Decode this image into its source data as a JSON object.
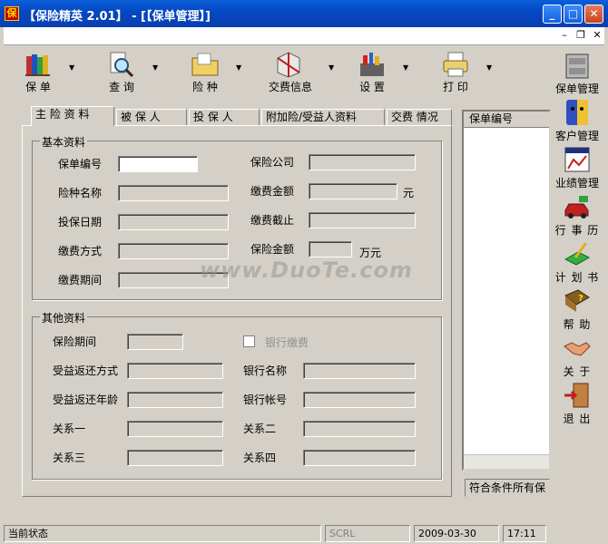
{
  "window": {
    "title": "【保险精英 2.01】 - [【保单管理】]"
  },
  "toolbar": {
    "items": [
      {
        "label": "保 单",
        "icon": "books-icon"
      },
      {
        "label": "查 询",
        "icon": "magnifier-icon"
      },
      {
        "label": "险 种",
        "icon": "folder-icon"
      },
      {
        "label": "交费信息",
        "icon": "wrapped-box-icon"
      },
      {
        "label": "设 置",
        "icon": "tools-icon"
      },
      {
        "label": "打 印",
        "icon": "printer-icon"
      }
    ]
  },
  "tabs": [
    "主 险 资 料",
    "被 保 人",
    "投 保 人",
    "附加险/受益人资料",
    "交费 情况"
  ],
  "basic": {
    "legend": "基本资料",
    "policy_no": "保单编号",
    "plan_name": "险种名称",
    "insure_date": "投保日期",
    "pay_method": "缴费方式",
    "pay_period": "缴费期间",
    "company": "保险公司",
    "pay_amount": "缴费金额",
    "pay_amount_unit": "元",
    "pay_deadline": "缴费截止",
    "insured_amount": "保险金额",
    "insured_amount_unit": "万元"
  },
  "other": {
    "legend": "其他资料",
    "period": "保险期间",
    "bank_pay": "银行缴费",
    "return_method": "受益返还方式",
    "bank_name": "银行名称",
    "return_age": "受益返还年龄",
    "bank_account": "银行帐号",
    "rel1": "关系一",
    "rel2": "关系二",
    "rel3": "关系三",
    "rel4": "关系四"
  },
  "rightlist": {
    "header": "保单编号",
    "footer": "符合条件所有保"
  },
  "sidebar": [
    {
      "label": "保单管理",
      "icon": "cabinet-icon"
    },
    {
      "label": "客户管理",
      "icon": "finder-face-icon"
    },
    {
      "label": "业绩管理",
      "icon": "chart-window-icon"
    },
    {
      "label": "行 事 历",
      "icon": "car-icon"
    },
    {
      "label": "计 划 书",
      "icon": "pen-icon"
    },
    {
      "label": "帮  助",
      "icon": "help-book-icon"
    },
    {
      "label": "关  于",
      "icon": "handshake-icon"
    },
    {
      "label": "退  出",
      "icon": "exit-door-icon"
    }
  ],
  "status": {
    "state": "当前状态",
    "scrl": "SCRL",
    "date": "2009-03-30",
    "time": "17:11"
  },
  "watermark": "www.DuoTe.com"
}
